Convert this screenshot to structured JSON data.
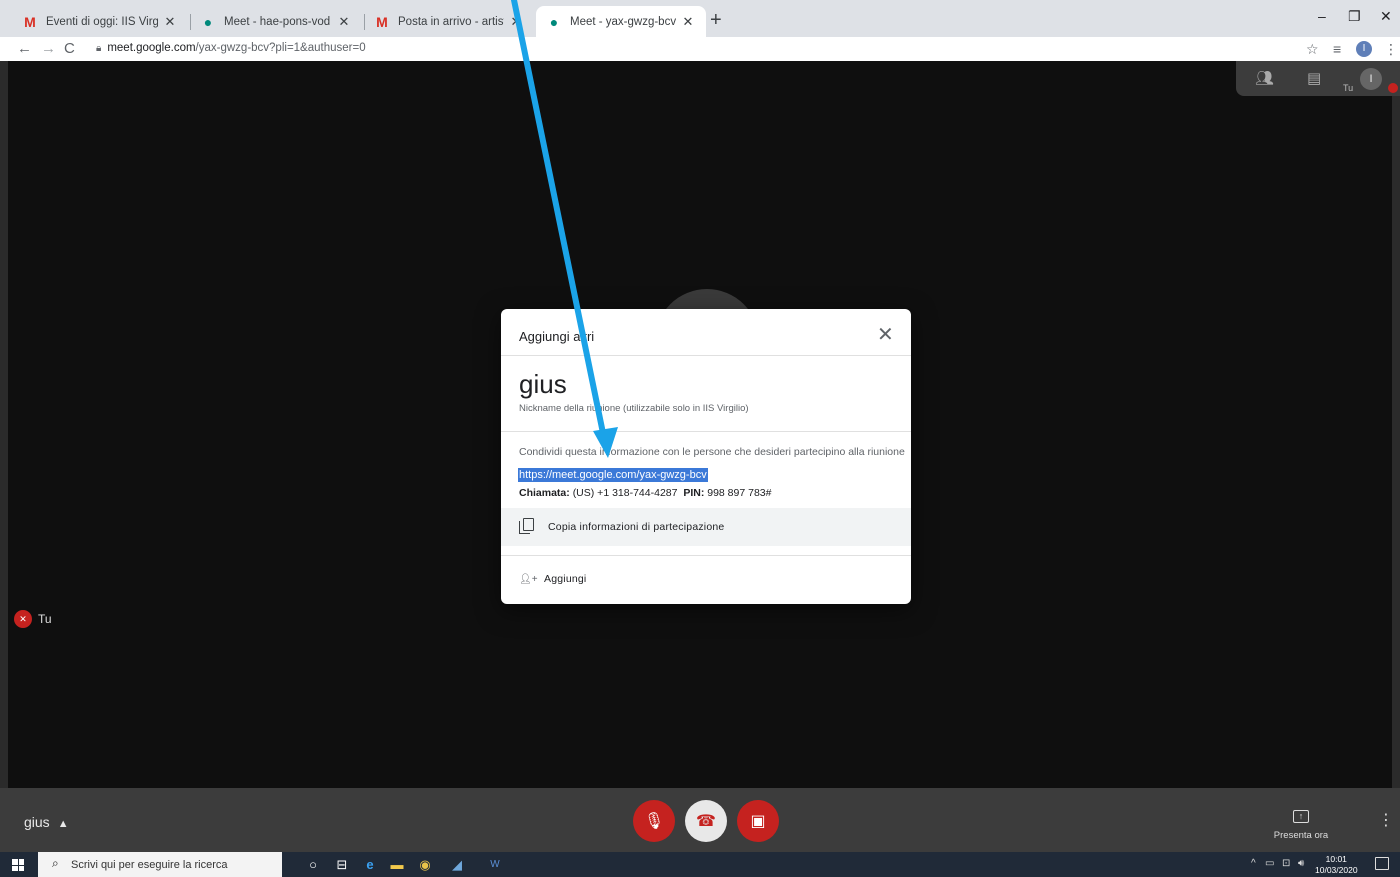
{
  "browser": {
    "tabs": [
      {
        "title": "Eventi di oggi: IIS Virgilio INFOTE",
        "favicon": "gmail-icon",
        "active": false
      },
      {
        "title": "Meet - hae-pons-vod",
        "favicon": "meet-icon",
        "active": false
      },
      {
        "title": "Posta in arrivo - artistico@virgili",
        "favicon": "gmail-icon",
        "active": false
      },
      {
        "title": "Meet - yax-gwzg-bcv",
        "favicon": "meet-icon",
        "active": true
      }
    ],
    "url_host": "meet.google.com",
    "url_path": "/yax-gwzg-bcv?pli=1&authuser=0",
    "profile_initial": "I"
  },
  "meet": {
    "self_label": "Tu",
    "topbar_tu": "Tu",
    "topbar_avatar_initial": "I",
    "meeting_name": "gius",
    "present_label": "Presenta ora"
  },
  "dialog": {
    "title": "Aggiungi altri",
    "nickname": "gius",
    "nickname_sub": "Nickname della riunione (utilizzabile solo in IIS Virgilio)",
    "share_text": "Condividi questa informazione con le persone che desideri partecipino alla riunione",
    "link": "https://meet.google.com/yax-gwzg-bcv",
    "dialin_label": "Chiamata:",
    "dialin_number": "(US) +1 318-744-4287",
    "pin_label": "PIN:",
    "pin_value": "998 897 783#",
    "copy_label": "Copia informazioni di partecipazione",
    "add_label": "Aggiungi"
  },
  "taskbar": {
    "search_placeholder": "Scrivi qui per eseguire la ricerca",
    "time": "10:01",
    "date": "10/03/2020"
  },
  "colors": {
    "meet_red": "#c5221f",
    "selection_blue": "#3b79d8",
    "annotation_arrow": "#1ba3e8"
  }
}
